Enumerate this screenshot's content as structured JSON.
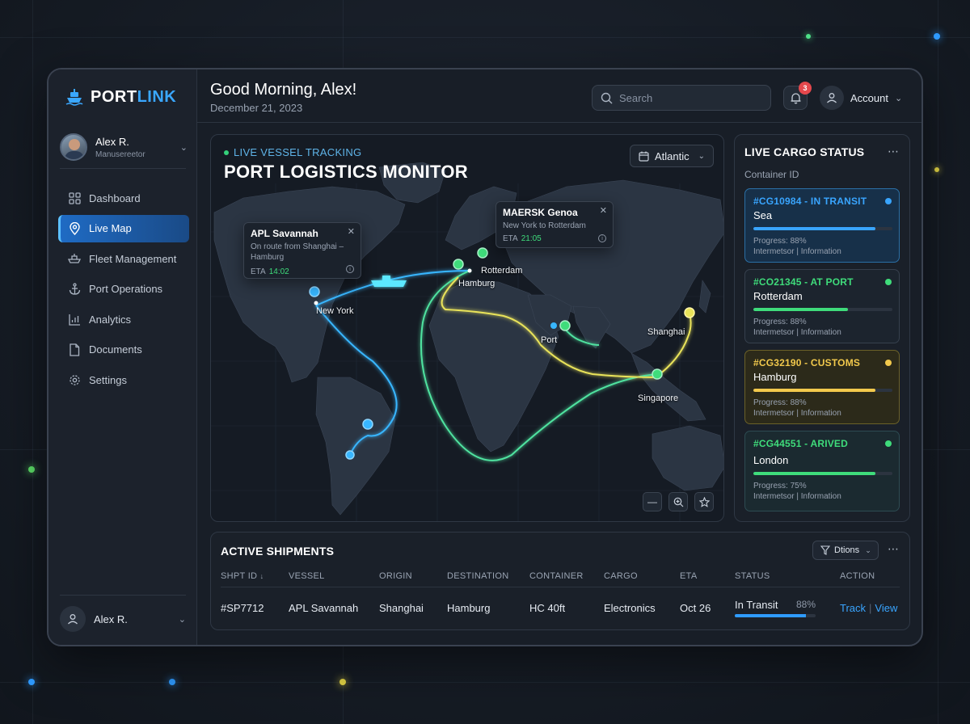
{
  "brand": {
    "part1": "PORT",
    "part2": "LINK"
  },
  "user": {
    "name": "Alex R.",
    "role": "Manusereetor"
  },
  "nav": [
    {
      "label": "Dashboard",
      "icon": "grid-icon"
    },
    {
      "label": "Live Map",
      "icon": "map-pin-icon",
      "active": true
    },
    {
      "label": "Fleet Management",
      "icon": "ship-icon"
    },
    {
      "label": "Port Operations",
      "icon": "anchor-icon"
    },
    {
      "label": "Analytics",
      "icon": "bar-chart-icon"
    },
    {
      "label": "Documents",
      "icon": "document-icon"
    },
    {
      "label": "Settings",
      "icon": "gear-icon"
    }
  ],
  "bottom_user": {
    "name": "Alex R."
  },
  "header": {
    "greeting": "Good Morning, Alex!",
    "date": "December 21, 2023",
    "search_placeholder": "Search",
    "notif_count": "3",
    "account_label": "Account"
  },
  "map": {
    "live_label": "LIVE VESSEL TRACKING",
    "title": "PORT LOGISTICS MONITOR",
    "region": "Atlantic",
    "popup1": {
      "title": "APL Savannah",
      "sub": "On route from Shanghai – Hamburg",
      "eta_label": "ETA",
      "eta": "14:02"
    },
    "popup2": {
      "title": "MAERSK Genoa",
      "sub": "New York to Rotterdam",
      "eta_label": "ETA",
      "eta": "21:05"
    },
    "labels": {
      "new_york": "New York",
      "hamburg": "Hamburg",
      "rotterdam": "Rotterdam",
      "port": "Port",
      "shanghai": "Shanghai",
      "singapore": "Singapore"
    },
    "colors": {
      "route_blue": "#38b6ff",
      "route_green": "#4fe3a0",
      "route_yellow": "#e9e35a"
    }
  },
  "cargo": {
    "title": "LIVE CARGO STATUS",
    "subtitle": "Container ID",
    "cards": [
      {
        "id": "#CG10984 - IN TRANSIT",
        "loc": "Sea",
        "progress_text": "Progress: 88%",
        "progress": 0.88,
        "info": "Intermetsor | Information",
        "color": "#39a5ff",
        "bg": "#173049",
        "border": "#2b6fa5"
      },
      {
        "id": "#CO21345 - AT PORT",
        "loc": "Rotterdam",
        "progress_text": "Progress: 88%",
        "progress": 0.68,
        "info": "Intermetsor | Information",
        "color": "#3fdc7b",
        "bg": "#1c242e",
        "border": "#36404d"
      },
      {
        "id": "#CG32190 - CUSTOMS",
        "loc": "Hamburg",
        "progress_text": "Progress: 88%",
        "progress": 0.88,
        "info": "Intermetsor | Information",
        "color": "#f2c94c",
        "bg": "#2c2a1a",
        "border": "#6b6128"
      },
      {
        "id": "#CG44551 - ARIVED",
        "loc": "London",
        "progress_text": "Progress: 75%",
        "progress": 0.88,
        "info": "Intermetsor | Information",
        "color": "#3fdc7b",
        "bg": "#1b2a30",
        "border": "#2d4b52"
      }
    ]
  },
  "shipments": {
    "title": "ACTIVE SHIPMENTS",
    "options_label": "Dtions",
    "headers": [
      "SHPT ID",
      "VESSEL",
      "ORIGIN",
      "DESTINATION",
      "CONTAINER",
      "CARGO",
      "ETA",
      "STATUS",
      "ACTION"
    ],
    "row": {
      "id": "#SP7712",
      "vessel": "APL Savannah",
      "origin": "Shanghai",
      "destination": "Hamburg",
      "container": "HC 40ft",
      "cargo": "Electronics",
      "eta": "Oct 26",
      "status": "In Transit",
      "pct": "88%",
      "progress": 0.88,
      "track": "Track",
      "view": "View"
    }
  }
}
